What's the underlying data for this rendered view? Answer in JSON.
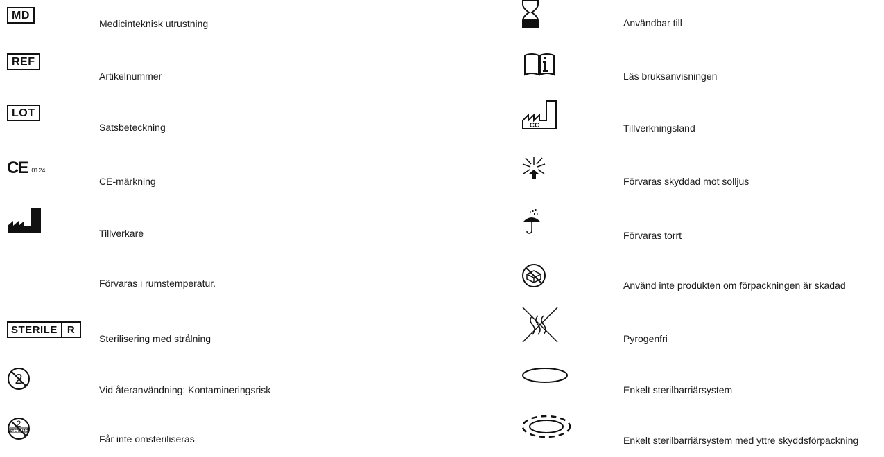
{
  "left": [
    {
      "symbol_text": "MD",
      "icon": "md-medical-device-icon",
      "label": "Medicinteknisk utrustning"
    },
    {
      "symbol_text": "REF",
      "icon": "ref-catalogue-number-icon",
      "label": "Artikelnummer"
    },
    {
      "symbol_text": "LOT",
      "icon": "lot-batch-code-icon",
      "label": "Satsbeteckning"
    },
    {
      "symbol_text": "CE",
      "symbol_sub": "0124",
      "icon": "ce-mark-icon",
      "label": "CE-märkning"
    },
    {
      "icon": "manufacturer-icon",
      "label": "Tillverkare"
    },
    {
      "label": "Förvaras i rumstemperatur."
    },
    {
      "symbol_text": "STERILE",
      "symbol_sub": "R",
      "icon": "sterile-r-icon",
      "label": "Sterilisering med strålning"
    },
    {
      "icon": "do-not-reuse-icon",
      "label": "Vid återanvändning: Kontamineringsrisk"
    },
    {
      "icon": "do-not-resterilize-icon",
      "icon_text": "STERILIZE",
      "label": "Får inte omsteriliseras"
    }
  ],
  "right": [
    {
      "icon": "hourglass-use-by-icon",
      "label": "Användbar till"
    },
    {
      "icon": "consult-instructions-icon",
      "label": "Läs bruksanvisningen"
    },
    {
      "icon": "country-of-manufacture-icon",
      "icon_text": "CC",
      "label": "Tillverkningsland"
    },
    {
      "icon": "keep-away-from-sunlight-icon",
      "label": "Förvaras skyddad mot solljus"
    },
    {
      "icon": "keep-dry-umbrella-icon",
      "label": "Förvaras torrt"
    },
    {
      "icon": "do-not-use-if-damaged-icon",
      "label": "Använd inte produkten om förpackningen är skadad"
    },
    {
      "icon": "non-pyrogenic-icon",
      "label": "Pyrogenfri"
    },
    {
      "icon": "single-sterile-barrier-icon",
      "label": "Enkelt sterilbarriärsystem"
    },
    {
      "icon": "sterile-barrier-with-protective-packaging-icon",
      "label": "Enkelt sterilbarriärsystem med yttre skyddsförpackning"
    }
  ]
}
